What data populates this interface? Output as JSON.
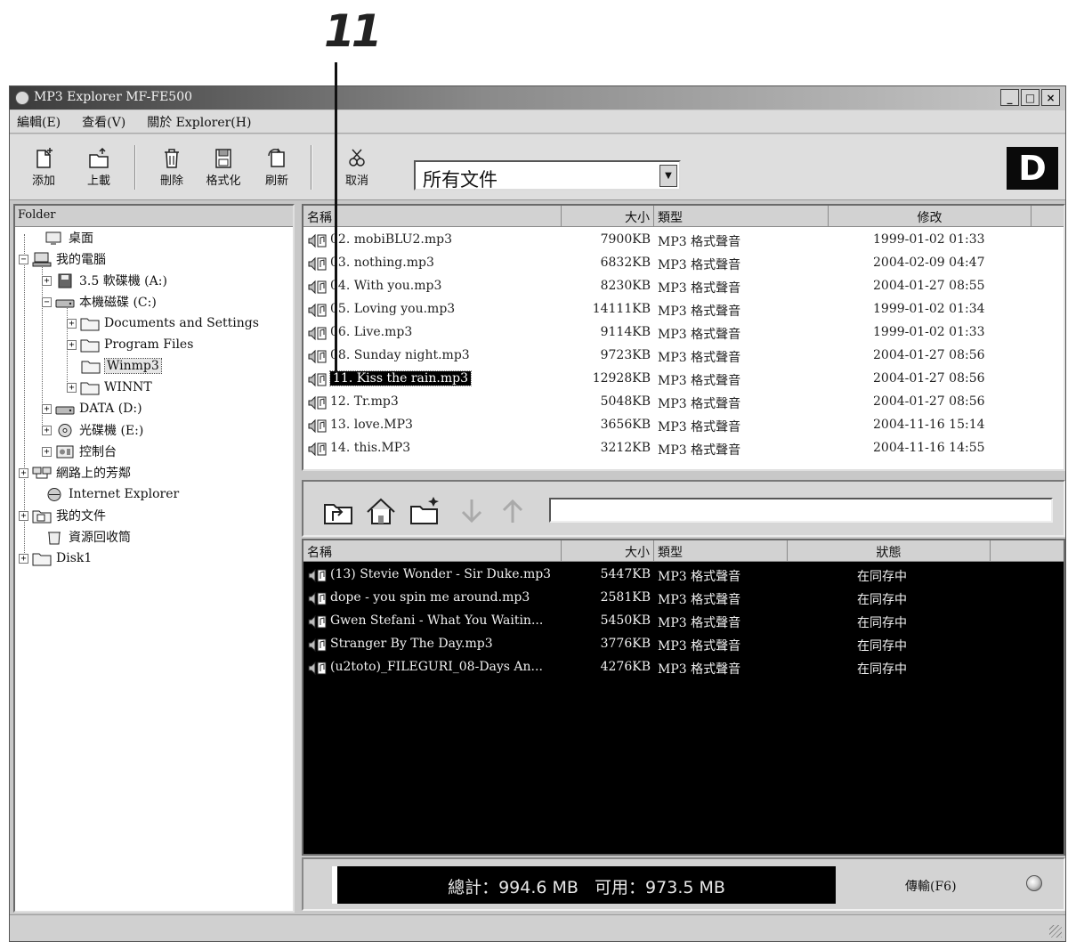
{
  "callout": {
    "number": "11"
  },
  "window": {
    "title": "MP3 Explorer MF-FE500",
    "controls": [
      "_",
      "□",
      "×"
    ]
  },
  "menu": [
    "編輯(E)",
    "查看(V)",
    "關於 Explorer(H)"
  ],
  "toolbar": {
    "buttons": [
      {
        "label": "添加",
        "icon": "add-file-icon"
      },
      {
        "label": "上載",
        "icon": "upload-icon"
      },
      {
        "label": "刪除",
        "icon": "delete-icon"
      },
      {
        "label": "格式化",
        "icon": "format-icon"
      },
      {
        "label": "刷新",
        "icon": "refresh-icon"
      },
      {
        "label": "取消",
        "icon": "cancel-icon"
      }
    ],
    "filter": {
      "selected": "所有文件"
    },
    "logo": "D"
  },
  "folder_panel": {
    "header": "Folder",
    "items": [
      {
        "label": "桌面",
        "icon": "desktop-icon"
      },
      {
        "label": "我的電腦",
        "icon": "computer-icon"
      },
      {
        "label": "3.5 軟碟機 (A:)",
        "icon": "floppy-icon"
      },
      {
        "label": "本機磁碟 (C:)",
        "icon": "hard-disk-icon"
      },
      {
        "label": "Documents and Settings",
        "icon": "folder-icon"
      },
      {
        "label": "Program Files",
        "icon": "folder-icon"
      },
      {
        "label": "Winmp3",
        "icon": "folder-icon"
      },
      {
        "label": "WINNT",
        "icon": "folder-icon"
      },
      {
        "label": "DATA (D:)",
        "icon": "hard-disk-icon"
      },
      {
        "label": "光碟機 (E:)",
        "icon": "cd-drive-icon"
      },
      {
        "label": "控制台",
        "icon": "control-panel-icon"
      },
      {
        "label": "網路上的芳鄰",
        "icon": "network-icon"
      },
      {
        "label": "Internet Explorer",
        "icon": "internet-explorer-icon"
      },
      {
        "label": "我的文件",
        "icon": "documents-folder-icon"
      },
      {
        "label": "資源回收筒",
        "icon": "recycle-bin-icon"
      },
      {
        "label": "Disk1",
        "icon": "folder-icon"
      }
    ]
  },
  "device_list": {
    "columns": [
      "名稱",
      "大小",
      "類型",
      "修改"
    ],
    "rows": [
      {
        "name": "02. mobiBLU2.mp3",
        "size": "7900KB",
        "type": "MP3 格式聲音",
        "modified": "1999-01-02 01:33"
      },
      {
        "name": "03. nothing.mp3",
        "size": "6832KB",
        "type": "MP3 格式聲音",
        "modified": "2004-02-09 04:47"
      },
      {
        "name": "04. With you.mp3",
        "size": "8230KB",
        "type": "MP3 格式聲音",
        "modified": "2004-01-27 08:55"
      },
      {
        "name": "05. Loving you.mp3",
        "size": "14111KB",
        "type": "MP3 格式聲音",
        "modified": "1999-01-02 01:34"
      },
      {
        "name": "06. Live.mp3",
        "size": "9114KB",
        "type": "MP3 格式聲音",
        "modified": "1999-01-02 01:33"
      },
      {
        "name": "08. Sunday night.mp3",
        "size": "9723KB",
        "type": "MP3 格式聲音",
        "modified": "2004-01-27 08:56"
      },
      {
        "name": "11. Kiss the rain.mp3",
        "size": "12928KB",
        "type": "MP3 格式聲音",
        "modified": "2004-01-27 08:56"
      },
      {
        "name": "12. Tr.mp3",
        "size": "5048KB",
        "type": "MP3 格式聲音",
        "modified": "2004-01-27 08:56"
      },
      {
        "name": "13. love.MP3",
        "size": "3656KB",
        "type": "MP3 格式聲音",
        "modified": "2004-11-16 15:14"
      },
      {
        "name": "14. this.MP3",
        "size": "3212KB",
        "type": "MP3 格式聲音",
        "modified": "2004-11-16 14:55"
      }
    ],
    "selected_index": 6
  },
  "nav_bar": {
    "buttons": [
      "up-folder-icon",
      "home-icon",
      "new-folder-icon",
      "download-arrow-icon",
      "upload-arrow-icon"
    ],
    "path": ""
  },
  "transfer_list": {
    "columns": [
      "名稱",
      "大小",
      "類型",
      "狀態"
    ],
    "rows": [
      {
        "name": "(13) Stevie Wonder - Sir Duke.mp3",
        "size": "5447KB",
        "type": "MP3 格式聲音",
        "status": "在同存中"
      },
      {
        "name": "dope - you spin me around.mp3",
        "size": "2581KB",
        "type": "MP3 格式聲音",
        "status": "在同存中"
      },
      {
        "name": "Gwen Stefani - What You Waitin...",
        "size": "5450KB",
        "type": "MP3 格式聲音",
        "status": "在同存中"
      },
      {
        "name": "Stranger By The Day.mp3",
        "size": "3776KB",
        "type": "MP3 格式聲音",
        "status": "在同存中"
      },
      {
        "name": "(u2toto)_FILEGURI_08-Days An...",
        "size": "4276KB",
        "type": "MP3 格式聲音",
        "status": "在同存中"
      }
    ]
  },
  "status": {
    "capacity": "總計：994.6 MB   可用：973.5 MB",
    "transfer_button": "傳輸(F6)"
  }
}
